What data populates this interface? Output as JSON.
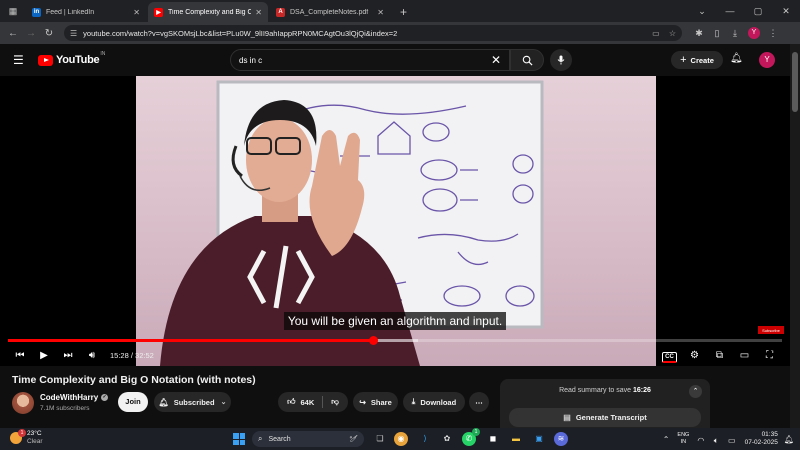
{
  "browser": {
    "tabs": [
      {
        "title": "Feed | LinkedIn",
        "icon": "linkedin-icon",
        "active": false
      },
      {
        "title": "Time Complexity and Big O No",
        "icon": "youtube-icon",
        "active": true
      },
      {
        "title": "DSA_CompleteNotes.pdf",
        "icon": "pdf-icon",
        "active": false
      }
    ],
    "new_tab": "+",
    "url": "youtube.com/watch?v=vgSKOMsjLbc&list=PLu0W_9lII9ahIappRPN0MCAgtOu3lQjQi&index=2",
    "profile_initial": "Y"
  },
  "youtube": {
    "logo_text": "YouTube",
    "country_code": "IN",
    "search_query": "ds in c",
    "create_label": "Create",
    "avatar_initial": "Y"
  },
  "player": {
    "caption": "You will be given an algorithm and input.",
    "current_time": "15:28",
    "duration": "32:52",
    "played_fraction": 0.471,
    "buffered_fraction": 0.53,
    "cc_label": "CC",
    "watermark": "Subscribe"
  },
  "video": {
    "title": "Time Complexity and Big O Notation (with notes)",
    "channel": "CodeWithHarry",
    "subscribers": "7.1M subscribers",
    "join_label": "Join",
    "subscribed_label": "Subscribed",
    "likes": "64K",
    "share_label": "Share",
    "download_label": "Download"
  },
  "summary": {
    "prefix": "Read summary to save",
    "time_saved": "16:26",
    "transcript_label": "Generate Transcript"
  },
  "taskbar": {
    "temp": "23°C",
    "condition": "Clear",
    "weather_alert": "1",
    "search_placeholder": "Search",
    "whatsapp_badge": "1",
    "lang_line1": "ENG",
    "lang_line2": "IN",
    "time": "01:35",
    "date": "07-02-2025"
  },
  "colors": {
    "youtube_red": "#ff0000",
    "background": "#0f0f0f",
    "pill": "#272727"
  }
}
